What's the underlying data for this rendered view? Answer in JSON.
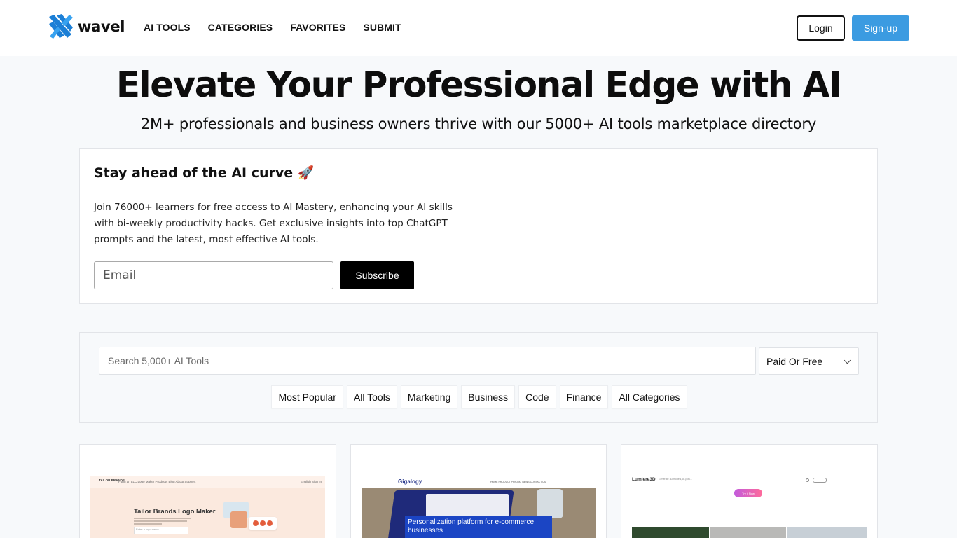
{
  "header": {
    "brand": "wavel",
    "nav": [
      "AI TOOLS",
      "CATEGORIES",
      "FAVORITES",
      "SUBMIT"
    ],
    "login_label": "Login",
    "signup_label": "Sign-up",
    "colors": {
      "signup_bg": "#3b9be1",
      "logo_blue": "#1c7fd6"
    }
  },
  "hero": {
    "title": "Elevate Your Professional Edge with AI",
    "subtitle": "2M+ professionals and business owners thrive with our 5000+ AI tools marketplace directory"
  },
  "newsletter": {
    "title": "Stay ahead of the AI curve 🚀",
    "body": "Join 76000+ learners for free access to AI Mastery, enhancing your AI skills with bi-weekly productivity hacks. Get exclusive insights into top ChatGPT prompts and the latest, most effective AI tools.",
    "email_placeholder": "Email",
    "subscribe_label": "Subscribe"
  },
  "search": {
    "placeholder": "Search 5,000+ AI Tools",
    "price_filter": "Paid Or Free",
    "chips": [
      "Most Popular",
      "All Tools",
      "Marketing",
      "Business",
      "Code",
      "Finance",
      "All Categories"
    ]
  },
  "cards": [
    {
      "name": "tailor-brands",
      "screenshot": {
        "logo": "TAILOR BRANDS",
        "nav": "Form an LLC   Logo Maker   Products   Blog   About   Support",
        "right_nav": "English   Sign In",
        "heading": "Tailor Brands Logo Maker",
        "input_placeholder": "Enter a logo name"
      }
    },
    {
      "name": "gigalogy",
      "screenshot": {
        "logo": "Gigalogy",
        "nav": "HOME   PRODUCT   PRICING   NEWS   CONTACT US",
        "banner": "Personalization platform for e-commerce businesses"
      }
    },
    {
      "name": "lumiere3d",
      "screenshot": {
        "logo": "Lumiere3D",
        "nav": "Generate 3D models, AI-pow...",
        "cta": "Try it Now"
      }
    }
  ]
}
